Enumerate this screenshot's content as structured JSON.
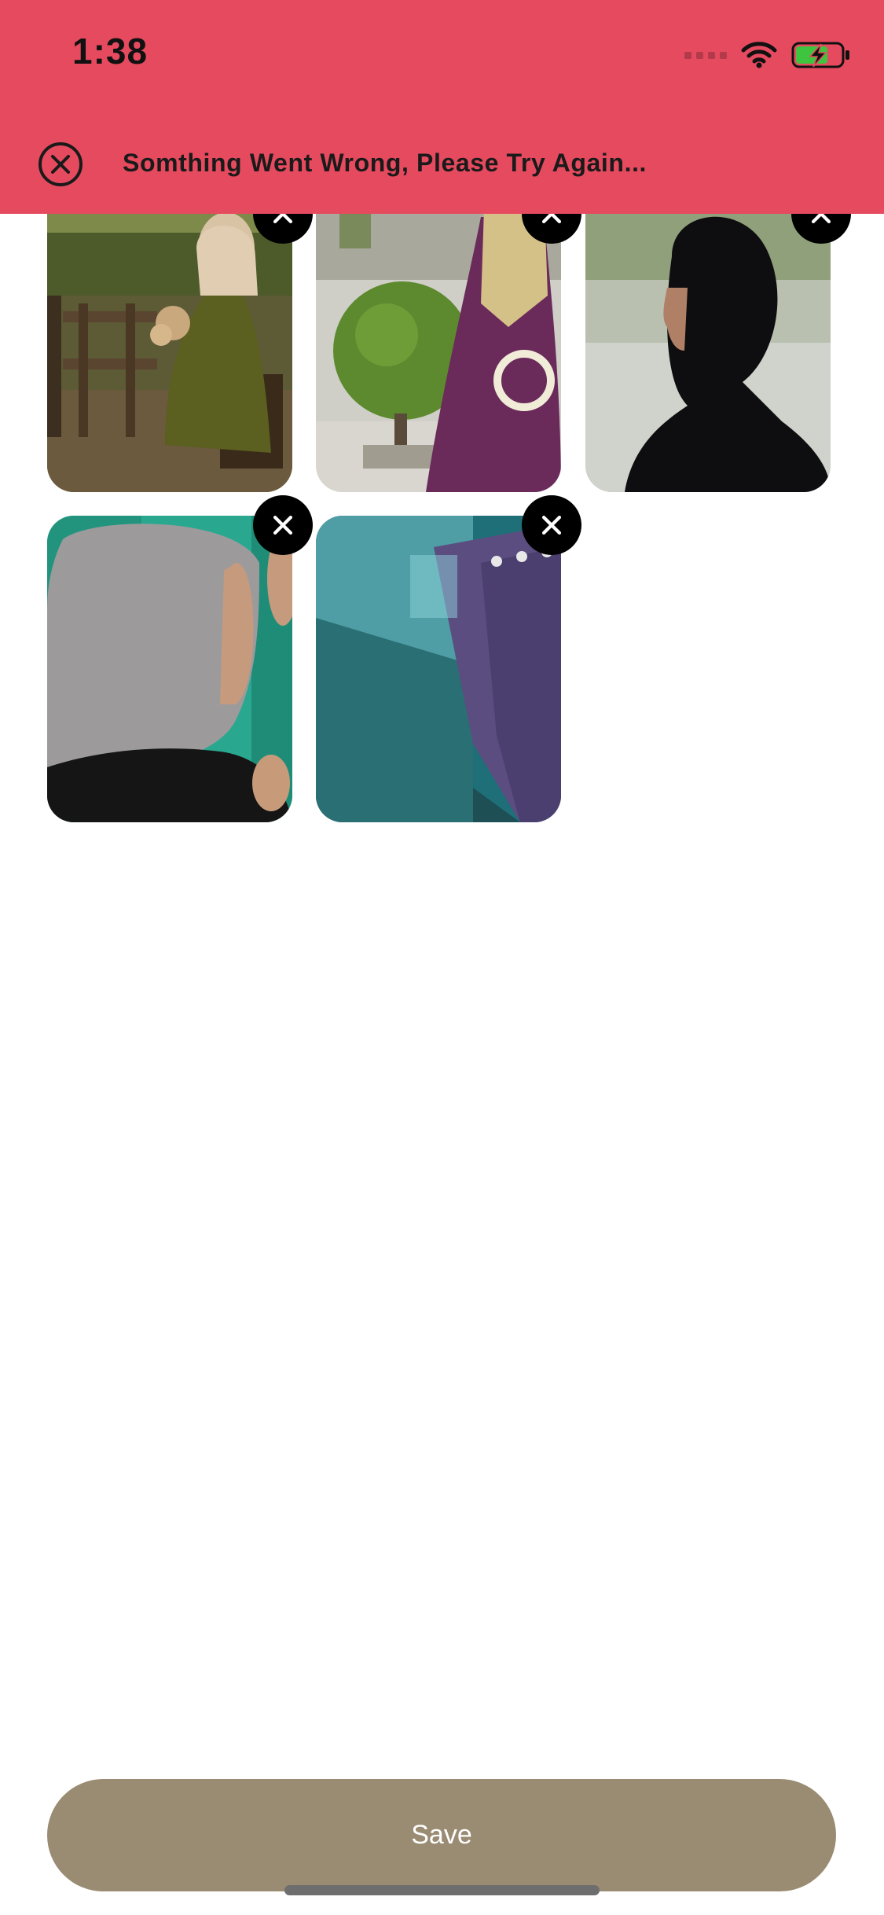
{
  "status_bar": {
    "time": "1:38"
  },
  "error_banner": {
    "message": "Somthing Went Wrong, Please Try Again...",
    "close_icon": "circle-x-icon",
    "background_color": "#e64a5f"
  },
  "photos": [
    {
      "description_icon": "photo-woman-olive-dress-icon",
      "removable": true
    },
    {
      "description_icon": "photo-woman-purple-dress-icon",
      "removable": true
    },
    {
      "description_icon": "photo-woman-black-hijab-icon",
      "removable": true
    },
    {
      "description_icon": "photo-woman-grey-hijab-icon",
      "removable": true
    },
    {
      "description_icon": "photo-curtain-wall-icon",
      "removable": true
    }
  ],
  "remove_icon": "x-icon",
  "save_button": {
    "label": "Save",
    "background_color": "#9a8b73"
  }
}
